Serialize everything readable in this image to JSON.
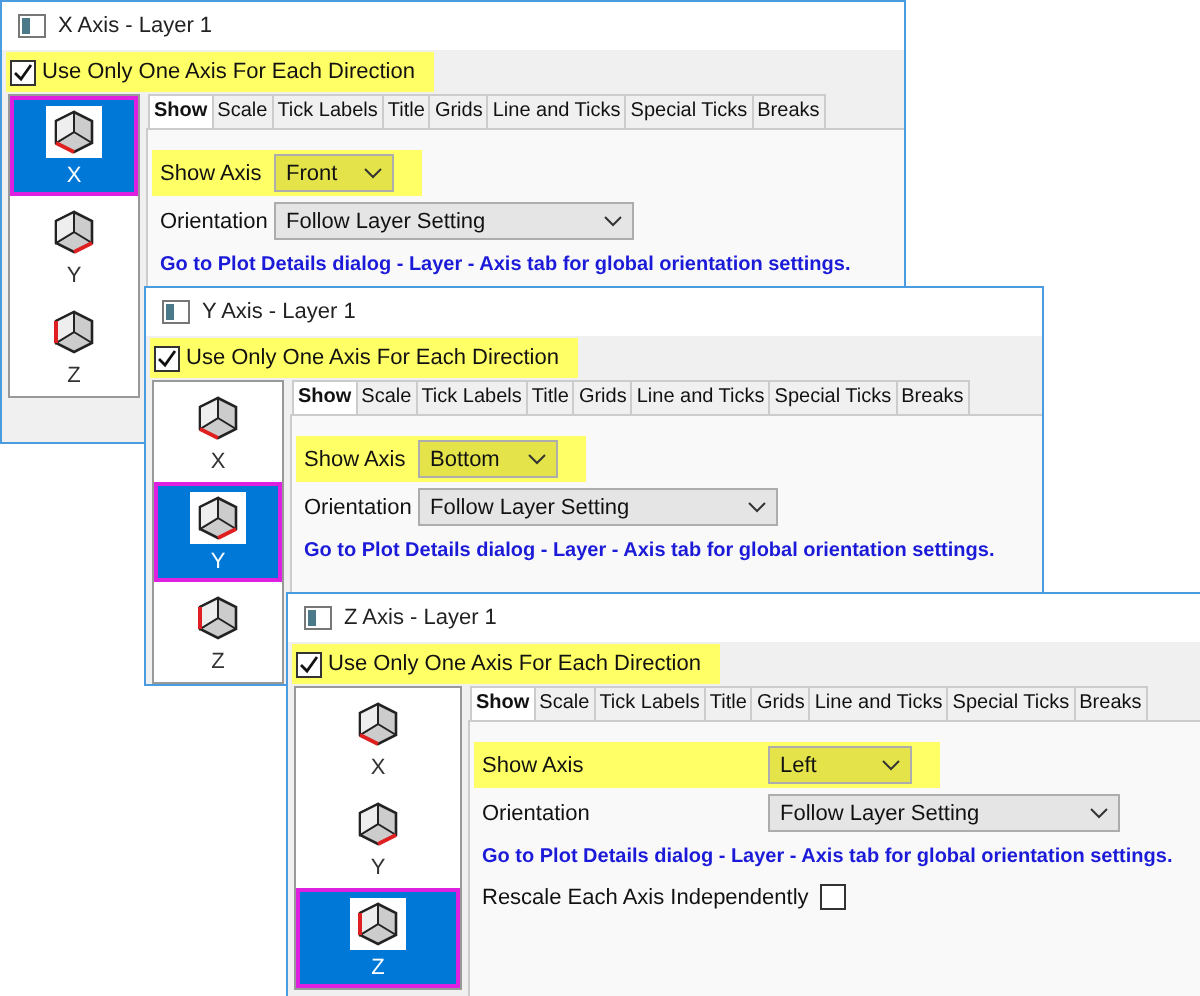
{
  "windows": [
    {
      "title": "X Axis - Layer 1",
      "use_one_axis": {
        "label": "Use Only One Axis For Each Direction",
        "checked": true,
        "highlighted": true
      },
      "axes": [
        {
          "label": "X",
          "selected": true
        },
        {
          "label": "Y",
          "selected": false
        },
        {
          "label": "Z",
          "selected": false
        }
      ],
      "tabs": [
        {
          "label": "Show",
          "selected": true
        },
        {
          "label": "Scale",
          "selected": false
        },
        {
          "label": "Tick Labels",
          "selected": false
        },
        {
          "label": "Title",
          "selected": false
        },
        {
          "label": "Grids",
          "selected": false
        },
        {
          "label": "Line and Ticks",
          "selected": false
        },
        {
          "label": "Special Ticks",
          "selected": false
        },
        {
          "label": "Breaks",
          "selected": false
        }
      ],
      "show_axis": {
        "label": "Show Axis",
        "value": "Front",
        "highlighted": true
      },
      "orientation": {
        "label": "Orientation",
        "value": "Follow Layer Setting"
      },
      "link": "Go to Plot Details dialog - Layer - Axis tab for global orientation settings."
    },
    {
      "title": "Y Axis - Layer 1",
      "use_one_axis": {
        "label": "Use Only One Axis For Each Direction",
        "checked": true,
        "highlighted": true
      },
      "axes": [
        {
          "label": "X",
          "selected": false
        },
        {
          "label": "Y",
          "selected": true
        },
        {
          "label": "Z",
          "selected": false
        }
      ],
      "tabs": [
        {
          "label": "Show",
          "selected": true
        },
        {
          "label": "Scale",
          "selected": false
        },
        {
          "label": "Tick Labels",
          "selected": false
        },
        {
          "label": "Title",
          "selected": false
        },
        {
          "label": "Grids",
          "selected": false
        },
        {
          "label": "Line and Ticks",
          "selected": false
        },
        {
          "label": "Special Ticks",
          "selected": false
        },
        {
          "label": "Breaks",
          "selected": false
        }
      ],
      "show_axis": {
        "label": "Show Axis",
        "value": "Bottom",
        "highlighted": true
      },
      "orientation": {
        "label": "Orientation",
        "value": "Follow Layer Setting"
      },
      "link": "Go to Plot Details dialog - Layer - Axis tab for global orientation settings."
    },
    {
      "title": "Z Axis - Layer 1",
      "use_one_axis": {
        "label": "Use Only One Axis For Each Direction",
        "checked": true,
        "highlighted": true
      },
      "axes": [
        {
          "label": "X",
          "selected": false
        },
        {
          "label": "Y",
          "selected": false
        },
        {
          "label": "Z",
          "selected": true
        }
      ],
      "tabs": [
        {
          "label": "Show",
          "selected": true
        },
        {
          "label": "Scale",
          "selected": false
        },
        {
          "label": "Tick Labels",
          "selected": false
        },
        {
          "label": "Title",
          "selected": false
        },
        {
          "label": "Grids",
          "selected": false
        },
        {
          "label": "Line and Ticks",
          "selected": false
        },
        {
          "label": "Special Ticks",
          "selected": false
        },
        {
          "label": "Breaks",
          "selected": false
        }
      ],
      "show_axis": {
        "label": "Show Axis",
        "value": "Left",
        "highlighted": true
      },
      "orientation": {
        "label": "Orientation",
        "value": "Follow Layer Setting"
      },
      "link": "Go to Plot Details dialog - Layer - Axis tab for global orientation settings.",
      "rescale": {
        "label": "Rescale Each Axis Independently",
        "checked": false
      }
    }
  ]
}
